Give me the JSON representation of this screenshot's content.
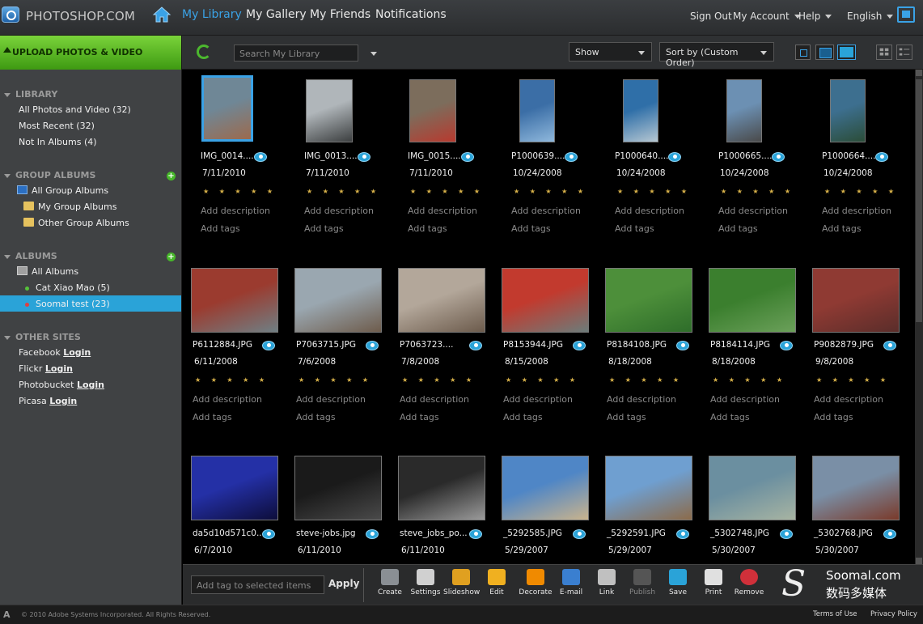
{
  "header": {
    "logo": "PHOTOSHOP.COM",
    "nav": [
      "My Library",
      "My Gallery",
      "My Friends",
      "Notifications"
    ],
    "sign_out": "Sign Out",
    "my_account": "My Account",
    "help": "Help",
    "language": "English"
  },
  "toolbar": {
    "upload": "UPLOAD PHOTOS & VIDEO",
    "search_placeholder": "Search My Library",
    "show": "Show",
    "sort": "Sort by (Custom Order)"
  },
  "sidebar": {
    "library_head": "LIBRARY",
    "library": [
      "All Photos and Video (32)",
      "Most Recent (32)",
      "Not In Albums (4)"
    ],
    "group_head": "GROUP ALBUMS",
    "group": [
      "All Group Albums",
      "My Group Albums",
      "Other Group Albums"
    ],
    "albums_head": "ALBUMS",
    "albums": [
      "All Albums",
      "Cat Xiao Mao (5)",
      "Soomal test (23)"
    ],
    "other_head": "OTHER SITES",
    "sites": [
      "Facebook",
      "Flickr",
      "Photobucket",
      "Picasa"
    ],
    "login": "Login"
  },
  "photos": [
    {
      "name": "IMG_0014....",
      "date": "7/11/2010"
    },
    {
      "name": "IMG_0013....",
      "date": "7/11/2010"
    },
    {
      "name": "IMG_0015....",
      "date": "7/11/2010"
    },
    {
      "name": "P1000639....",
      "date": "10/24/2008"
    },
    {
      "name": "P1000640....",
      "date": "10/24/2008"
    },
    {
      "name": "P1000665....",
      "date": "10/24/2008"
    },
    {
      "name": "P1000664....",
      "date": "10/24/2008"
    },
    {
      "name": "P6112884.JPG",
      "date": "6/11/2008"
    },
    {
      "name": "P7063715.JPG",
      "date": "7/6/2008"
    },
    {
      "name": "P7063723....",
      "date": "7/8/2008"
    },
    {
      "name": "P8153944.JPG",
      "date": "8/15/2008"
    },
    {
      "name": "P8184108.JPG",
      "date": "8/18/2008"
    },
    {
      "name": "P8184114.JPG",
      "date": "8/18/2008"
    },
    {
      "name": "P9082879.JPG",
      "date": "9/8/2008"
    },
    {
      "name": "da5d10d571c0...",
      "date": "6/7/2010"
    },
    {
      "name": "steve-jobs.jpg",
      "date": "6/11/2010"
    },
    {
      "name": "steve_jobs_po...",
      "date": "6/11/2010"
    },
    {
      "name": "_5292585.JPG",
      "date": "5/29/2007"
    },
    {
      "name": "_5292591.JPG",
      "date": "5/29/2007"
    },
    {
      "name": "_5302748.JPG",
      "date": "5/30/2007"
    },
    {
      "name": "_5302768.JPG",
      "date": "5/30/2007"
    }
  ],
  "photo_labels": {
    "stars": "★ ★ ★ ★ ★",
    "desc": "Add description",
    "tags": "Add tags"
  },
  "bottombar": {
    "tag_placeholder": "Add tag to selected items",
    "apply": "Apply",
    "actions": [
      "Create",
      "Settings",
      "Slideshow",
      "Edit",
      "Decorate",
      "E-mail",
      "Link",
      "Publish",
      "Save",
      "Print",
      "Remove"
    ],
    "watermark_1": "Soomal.com",
    "watermark_2": "数码多媒体"
  },
  "footer": {
    "copyright": "© 2010 Adobe Systems Incorporated. All Rights Reserved.",
    "terms": "Terms of Use",
    "privacy": "Privacy Policy"
  },
  "colors": {
    "accent": "#2aa3d8",
    "upload_green": "#5bbf1f",
    "star": "#d8b24a"
  }
}
